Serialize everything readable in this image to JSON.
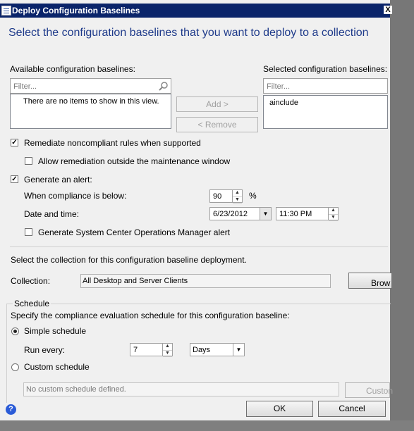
{
  "window": {
    "title": "Deploy Configuration Baselines",
    "close_glyph": "X"
  },
  "heading": "Select the configuration baselines that you want to deploy to a collection",
  "available": {
    "label": "Available configuration baselines:",
    "filter_placeholder": "Filter...",
    "empty_text": "There are no items to show in this view."
  },
  "selected": {
    "label": "Selected configuration baselines:",
    "filter_placeholder": "Filter...",
    "items": [
      "ainclude"
    ]
  },
  "buttons": {
    "add": "Add >",
    "remove": "< Remove",
    "browse": "Brow",
    "custom": "Custon",
    "ok": "OK",
    "cancel": "Cancel"
  },
  "options": {
    "remediate": {
      "label": "Remediate noncompliant rules when supported",
      "checked": true
    },
    "allow_remediation": {
      "label": "Allow remediation outside the maintenance window",
      "checked": false
    },
    "generate_alert": {
      "label": "Generate an alert:",
      "checked": true
    },
    "compliance_label": "When compliance is below:",
    "compliance_value": "90",
    "percent": "%",
    "datetime_label": "Date and time:",
    "date_value": "6/23/2012",
    "time_value": "11:30 PM",
    "scom_alert": {
      "label": "Generate System Center Operations Manager alert",
      "checked": false
    }
  },
  "collection": {
    "intro": "Select the collection for this configuration baseline deployment.",
    "label": "Collection:",
    "value": "All Desktop and Server Clients"
  },
  "schedule": {
    "group_label": "Schedule",
    "intro": "Specify the compliance evaluation schedule for this configuration baseline:",
    "simple_label": "Simple schedule",
    "run_every_label": "Run every:",
    "run_every_value": "7",
    "unit_value": "Days",
    "custom_label": "Custom schedule",
    "custom_placeholder": "No custom schedule defined."
  },
  "colors": {
    "title_bar": "#0a246a",
    "heading": "#1e3a8a"
  }
}
